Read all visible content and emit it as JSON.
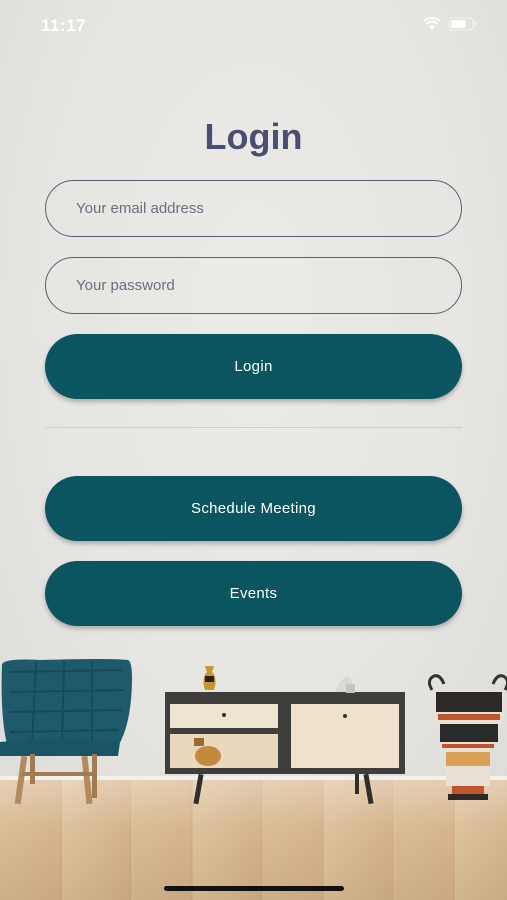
{
  "status_bar": {
    "time": "11:17",
    "icons": [
      "wifi-icon",
      "battery-icon"
    ]
  },
  "page": {
    "title": "Login"
  },
  "form": {
    "email_placeholder": "Your email address",
    "password_placeholder": "Your password",
    "login_label": "Login"
  },
  "actions": {
    "schedule_label": "Schedule Meeting",
    "events_label": "Events"
  },
  "colors": {
    "primary": "#0b5560",
    "title": "#4a4e72",
    "background": "#e8e7e3"
  },
  "background_scene": [
    "armchair",
    "sideboard",
    "vase",
    "amphora",
    "wooden-floor"
  ]
}
